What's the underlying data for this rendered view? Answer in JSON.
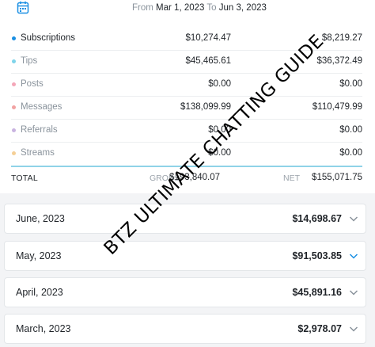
{
  "date_range": {
    "from_label": "From",
    "from_value": "Mar 1, 2023",
    "to_label": "To",
    "to_value": "Jun 3, 2023"
  },
  "breakdown": [
    {
      "label": "Subscriptions",
      "gross": "$10,274.47",
      "net": "$8,219.27",
      "dot_color": "#1a8fe3"
    },
    {
      "label": "Tips",
      "gross": "$45,465.61",
      "net": "$36,372.49",
      "dot_color": "#7fd4ea"
    },
    {
      "label": "Posts",
      "gross": "$0.00",
      "net": "$0.00",
      "dot_color": "#f4a6b8"
    },
    {
      "label": "Messages",
      "gross": "$138,099.99",
      "net": "$110,479.99",
      "dot_color": "#f2a2a2"
    },
    {
      "label": "Referrals",
      "gross": "$0.00",
      "net": "$0.00",
      "dot_color": "#c9b3e0"
    },
    {
      "label": "Streams",
      "gross": "$0.00",
      "net": "$0.00",
      "dot_color": "#f5cf96"
    }
  ],
  "totals": {
    "total_label": "TOTAL",
    "gross_label": "GROSS",
    "gross_value": "$193,840.07",
    "net_label": "NET",
    "net_value": "$155,071.75"
  },
  "months": [
    {
      "label": "June, 2023",
      "amount": "$14,698.67",
      "chevron_color": "#8a939c",
      "chevron": "chevron-down-icon"
    },
    {
      "label": "May, 2023",
      "amount": "$91,503.85",
      "chevron_color": "#1a8fe3",
      "chevron": "chevron-down-icon"
    },
    {
      "label": "April, 2023",
      "amount": "$45,891.16",
      "chevron_color": "#8a939c",
      "chevron": "chevron-down-icon"
    },
    {
      "label": "March, 2023",
      "amount": "$2,978.07",
      "chevron_color": "#8a939c",
      "chevron": "chevron-down-icon"
    }
  ],
  "watermark": "BTZ ULTIMATE CHATTING GUIDE",
  "colors": {
    "accent": "#1a8fe3",
    "divider": "#8fd3e8"
  }
}
